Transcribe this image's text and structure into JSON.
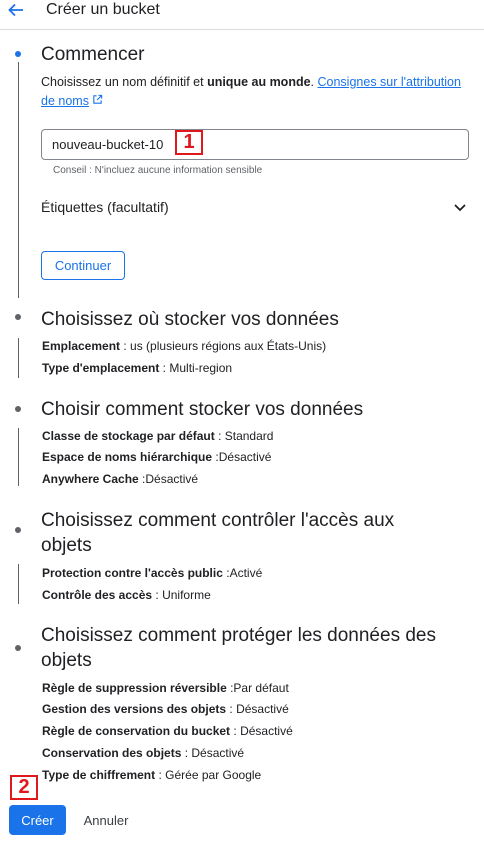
{
  "header": {
    "title": "Créer un bucket"
  },
  "step1": {
    "title": "Commencer",
    "desc_part1": "Choisissez un nom définitif et ",
    "desc_bold": "unique au monde",
    "desc_part2": ". ",
    "link": "Consignes sur l'attribution de noms",
    "input_value": "nouveau-bucket-10",
    "hint": "Conseil : N'incluez aucune information sensible",
    "labels": "Étiquettes (facultatif)",
    "continue": "Continuer"
  },
  "step2": {
    "title": "Choisissez où stocker vos données",
    "rows": [
      {
        "label": "Emplacement",
        "sep": " : ",
        "value": "us (plusieurs régions aux États-Unis)"
      },
      {
        "label": "Type d'emplacement",
        "sep": " : ",
        "value": "Multi-region"
      }
    ]
  },
  "step3": {
    "title": "Choisir comment stocker vos données",
    "rows": [
      {
        "label": "Classe de stockage par défaut",
        "sep": " : ",
        "value": "Standard"
      },
      {
        "label": "Espace de noms hiérarchique",
        "sep": " :",
        "value": "Désactivé"
      },
      {
        "label": "Anywhere Cache",
        "sep": " :",
        "value": "Désactivé"
      }
    ]
  },
  "step4": {
    "title_line1": "Choisissez comment contrôler l'accès aux",
    "title_line2": "objets",
    "rows": [
      {
        "label": "Protection contre l'accès public",
        "sep": " :",
        "value": "Activé"
      },
      {
        "label": "Contrôle des accès",
        "sep": " : ",
        "value": "Uniforme"
      }
    ]
  },
  "step5": {
    "title_line1": "Choisissez comment protéger les données des",
    "title_line2": "objets",
    "rows": [
      {
        "label": "Règle de suppression réversible",
        "sep": " :",
        "value": "Par défaut"
      },
      {
        "label": "Gestion des versions des objets",
        "sep": " : ",
        "value": "Désactivé"
      },
      {
        "label": "Règle de conservation du bucket",
        "sep": " : ",
        "value": "Désactivé"
      },
      {
        "label": "Conservation des objets",
        "sep": " : ",
        "value": "Désactivé"
      },
      {
        "label": "Type de chiffrement",
        "sep": " : ",
        "value": "Gérée par Google"
      }
    ]
  },
  "actions": {
    "create": "Créer",
    "cancel": "Annuler"
  },
  "markers": {
    "m1": "1",
    "m2": "2"
  },
  "icons": {
    "back": "arrow-back-icon",
    "chevron": "chevron-down-icon",
    "external": "external-link-icon"
  },
  "colors": {
    "accent": "#1a73e8",
    "marker": "#e0171d"
  }
}
